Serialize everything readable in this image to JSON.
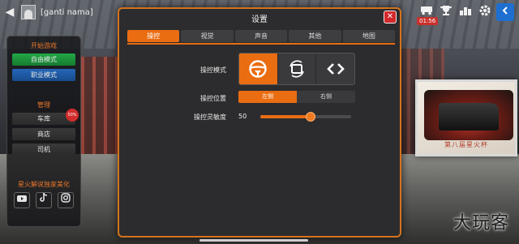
{
  "player": {
    "name": "[ganti nama]"
  },
  "hud": {
    "timer": "01:56",
    "icons": [
      "vehicle-icon",
      "trophy-icon",
      "ranking-icon",
      "gear-icon",
      "share-icon"
    ]
  },
  "side_menu": {
    "start_header": "开始游戏",
    "free_mode": "自由模式",
    "career_mode": "职业模式",
    "manage_header": "管理",
    "garage": "车库",
    "garage_badge": "50%",
    "shop": "商店",
    "driver": "司机",
    "promo_text": "星火解说独家美化"
  },
  "settings": {
    "title": "设置",
    "tabs": [
      "操控",
      "视觉",
      "声音",
      "其他",
      "地图"
    ],
    "active_tab": 0,
    "control_mode_label": "操控模式",
    "control_mode_active": 0,
    "control_position_label": "操控位置",
    "position_options": [
      "左侧",
      "右侧"
    ],
    "position_active": 0,
    "sensitivity_label": "操控灵敏度",
    "sensitivity_value": "50",
    "sensitivity_fraction": 0.55
  },
  "billboard": {
    "caption": "第八届星火杯"
  },
  "watermark": "大玩客",
  "colors": {
    "accent": "#ea6d12",
    "close": "#d2282c",
    "green": "#22a845",
    "blue": "#2466b9"
  }
}
